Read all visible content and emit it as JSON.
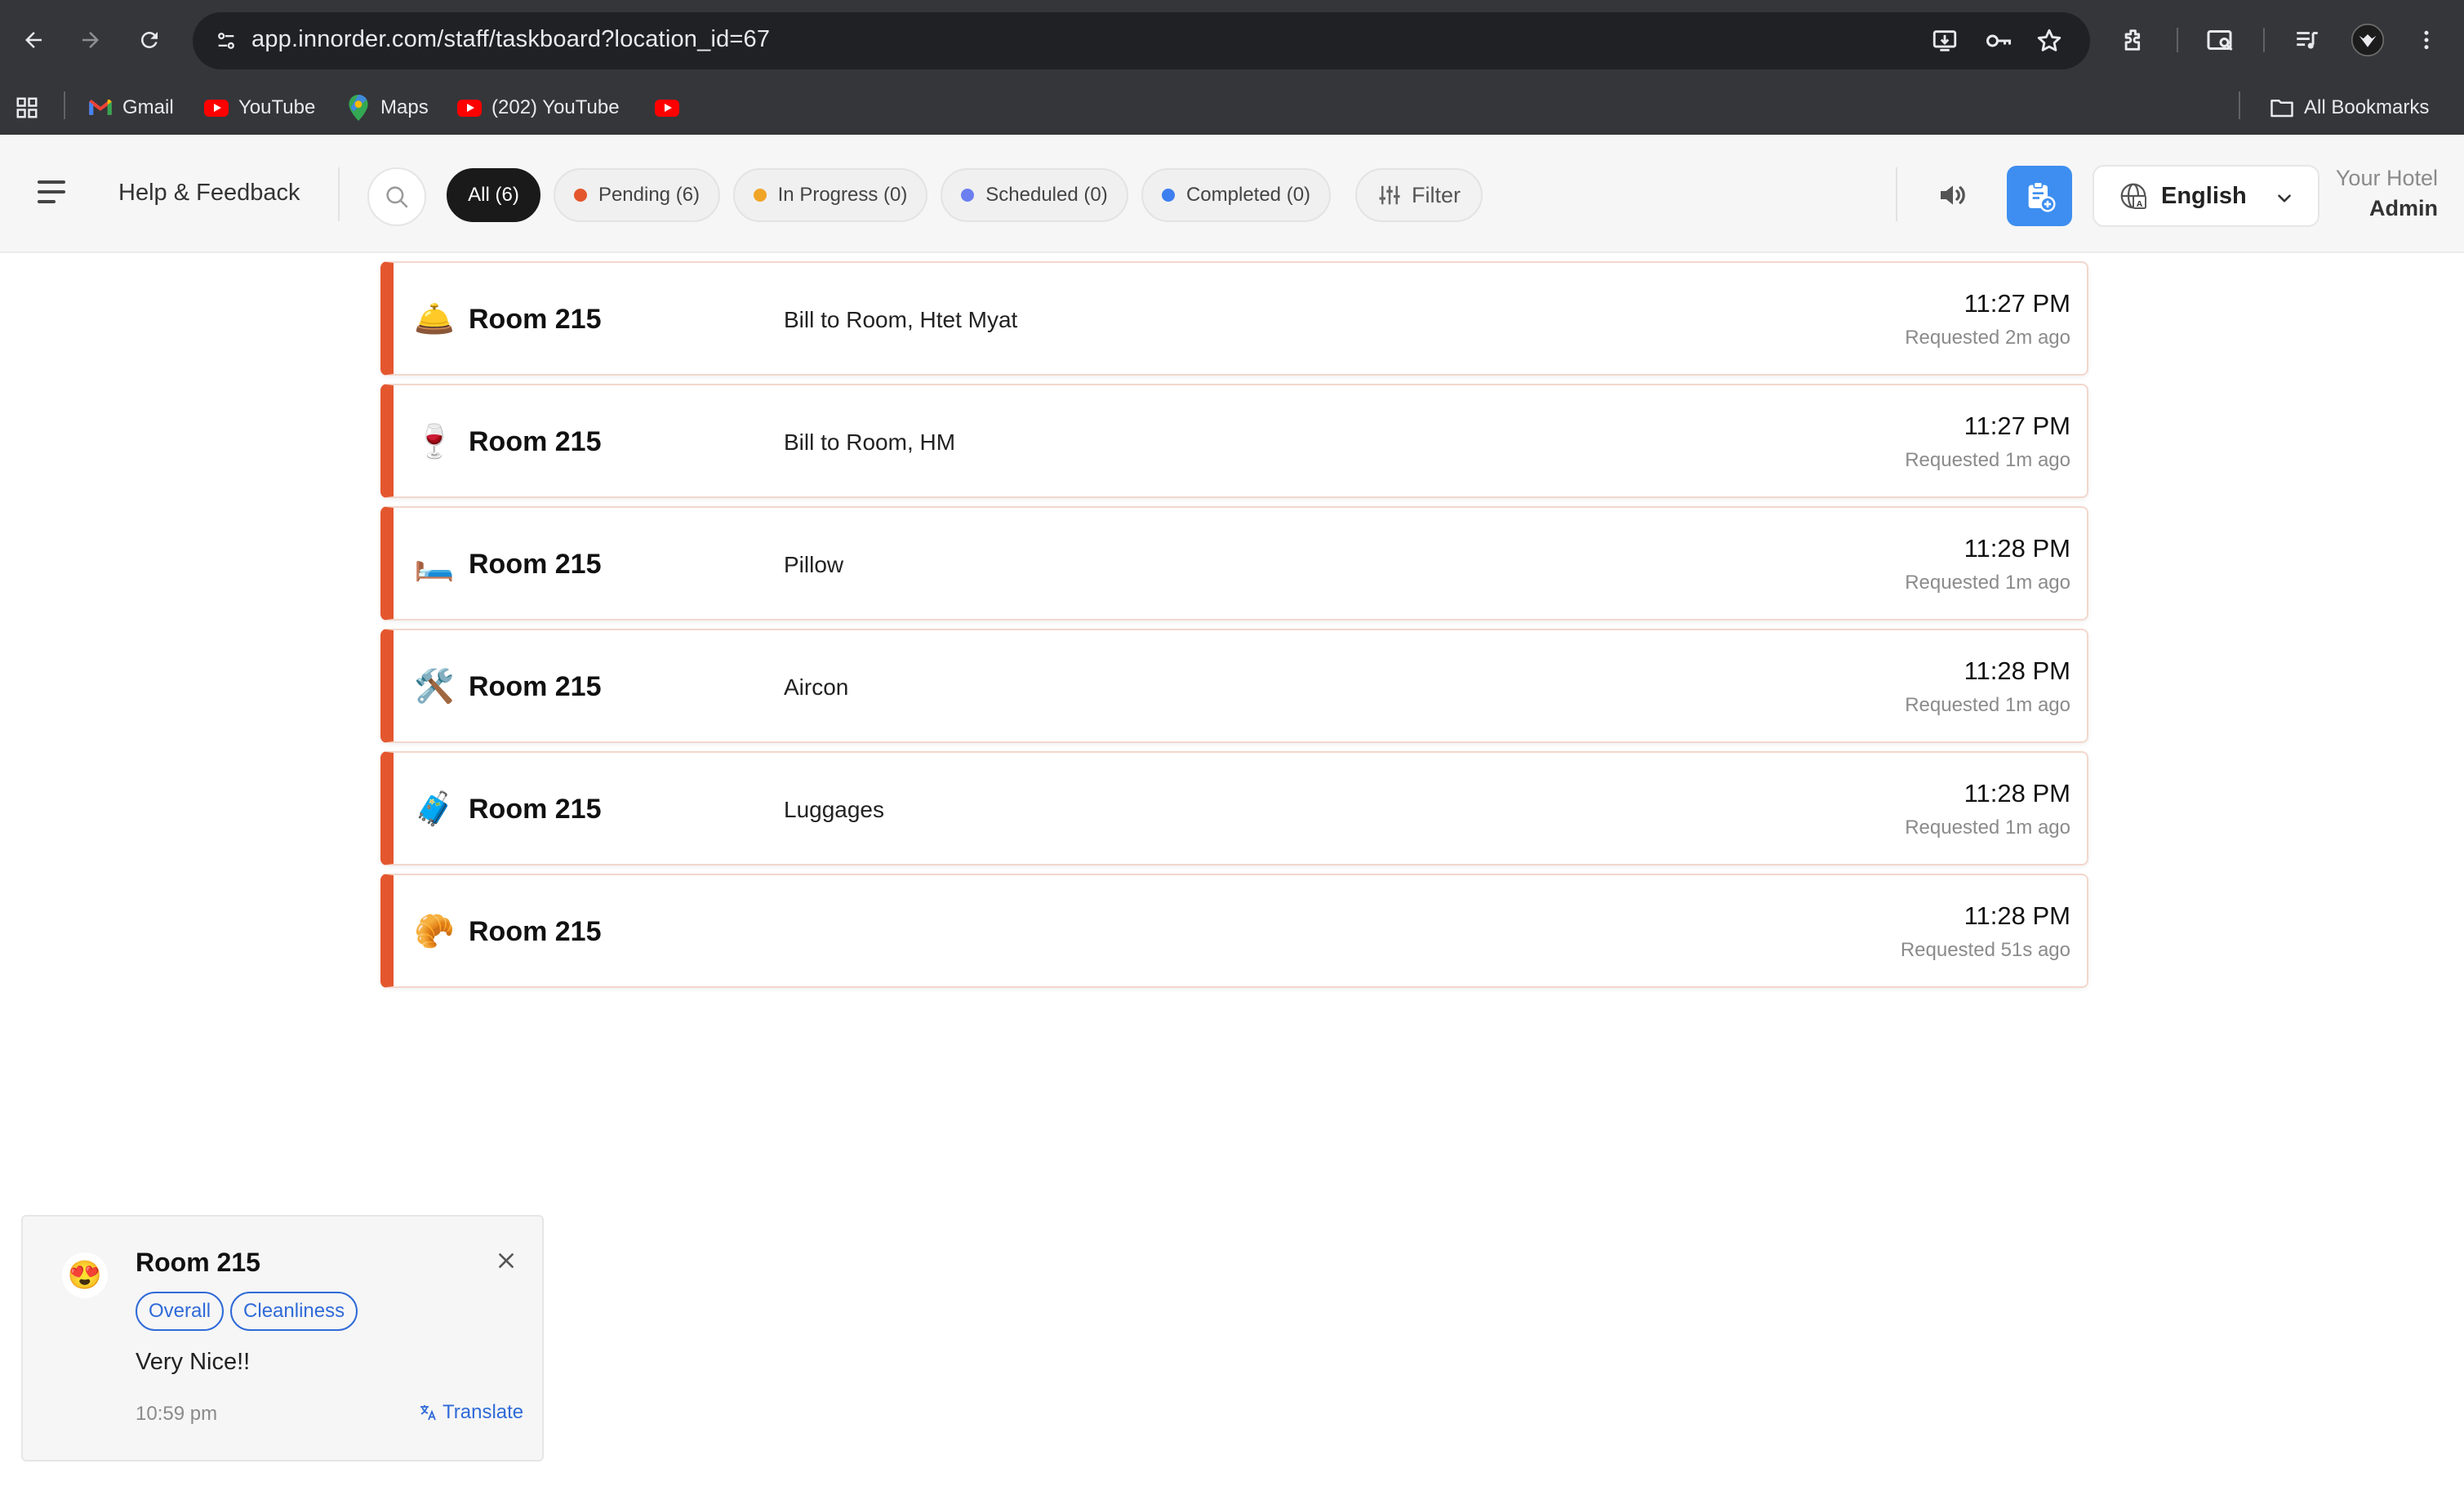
{
  "browser": {
    "url": "app.innorder.com/staff/taskboard?location_id=67",
    "bookmarks": [
      {
        "label": "Gmail",
        "icon": "gmail-icon"
      },
      {
        "label": "YouTube",
        "icon": "youtube-icon"
      },
      {
        "label": "Maps",
        "icon": "maps-icon"
      },
      {
        "label": "(202) YouTube",
        "icon": "youtube-icon"
      },
      {
        "label": "",
        "icon": "youtube-icon"
      }
    ],
    "all_bookmarks": "All Bookmarks"
  },
  "header": {
    "help": "Help & Feedback",
    "tabs": [
      {
        "label": "All (6)",
        "active": true
      },
      {
        "label": "Pending (6)",
        "dot_color": "#e4572e"
      },
      {
        "label": "In Progress (0)",
        "dot_color": "#f0a526"
      },
      {
        "label": "Scheduled (0)",
        "dot_color": "#6b7ff0"
      },
      {
        "label": "Completed (0)",
        "dot_color": "#3d7ff0"
      }
    ],
    "filter": "Filter",
    "language": "English",
    "hotel_label": "Your Hotel",
    "hotel_user": "Admin",
    "accent": "#3d8ef0"
  },
  "tasks": [
    {
      "icon": "bellhop-icon",
      "glyph": "🛎️",
      "room": "Room 215",
      "desc": "Bill to Room, Htet Myat",
      "time": "11:27 PM",
      "requested": "Requested 2m ago"
    },
    {
      "icon": "wine-icon",
      "glyph": "🍷",
      "room": "Room 215",
      "desc": "Bill to Room, HM",
      "time": "11:27 PM",
      "requested": "Requested 1m ago"
    },
    {
      "icon": "pillow-icon",
      "glyph": "🛏️",
      "room": "Room 215",
      "desc": "Pillow",
      "time": "11:28 PM",
      "requested": "Requested 1m ago"
    },
    {
      "icon": "tools-icon",
      "glyph": "🛠️",
      "room": "Room 215",
      "desc": "Aircon",
      "time": "11:28 PM",
      "requested": "Requested 1m ago"
    },
    {
      "icon": "luggage-icon",
      "glyph": "🧳",
      "room": "Room 215",
      "desc": "Luggages",
      "time": "11:28 PM",
      "requested": "Requested 1m ago"
    },
    {
      "icon": "food-icon",
      "glyph": "🥐",
      "room": "Room 215",
      "desc": "",
      "time": "11:28 PM",
      "requested": "Requested 51s ago"
    }
  ],
  "toast": {
    "emoji": "😍",
    "room": "Room 215",
    "tags": [
      "Overall",
      "Cleanliness"
    ],
    "message": "Very Nice!!",
    "time": "10:59 pm",
    "translate": "Translate"
  }
}
